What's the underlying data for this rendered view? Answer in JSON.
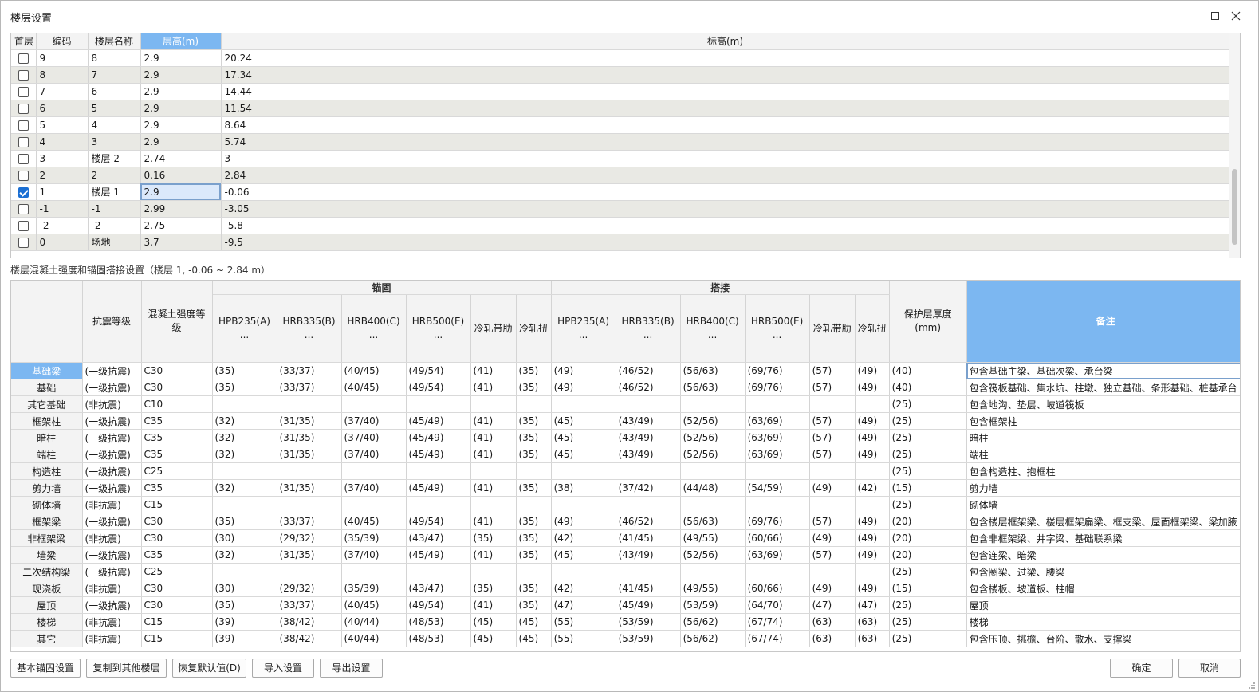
{
  "window": {
    "title": "楼层设置",
    "maximize_icon": "maximize-icon",
    "close_icon": "close-icon"
  },
  "floor_table": {
    "headers": [
      "首层",
      "编码",
      "楼层名称",
      "层高(m)",
      "标高(m)"
    ],
    "rows": [
      {
        "checked": false,
        "code": "9",
        "name": "8",
        "height": "2.9",
        "elevation": "20.24"
      },
      {
        "checked": false,
        "code": "8",
        "name": "7",
        "height": "2.9",
        "elevation": "17.34"
      },
      {
        "checked": false,
        "code": "7",
        "name": "6",
        "height": "2.9",
        "elevation": "14.44"
      },
      {
        "checked": false,
        "code": "6",
        "name": "5",
        "height": "2.9",
        "elevation": "11.54"
      },
      {
        "checked": false,
        "code": "5",
        "name": "4",
        "height": "2.9",
        "elevation": "8.64"
      },
      {
        "checked": false,
        "code": "4",
        "name": "3",
        "height": "2.9",
        "elevation": "5.74"
      },
      {
        "checked": false,
        "code": "3",
        "name": "楼层 2",
        "height": "2.74",
        "elevation": "3"
      },
      {
        "checked": false,
        "code": "2",
        "name": "2",
        "height": "0.16",
        "elevation": "2.84"
      },
      {
        "checked": true,
        "code": "1",
        "name": "楼层 1",
        "height": "2.9",
        "elevation": "-0.06"
      },
      {
        "checked": false,
        "code": "-1",
        "name": "-1",
        "height": "2.99",
        "elevation": "-3.05"
      },
      {
        "checked": false,
        "code": "-2",
        "name": "-2",
        "height": "2.75",
        "elevation": "-5.8"
      },
      {
        "checked": false,
        "code": "0",
        "name": "场地",
        "height": "3.7",
        "elevation": "-9.5"
      }
    ]
  },
  "section_label": "楼层混凝土强度和锚固搭接设置（楼层 1, -0.06 ~ 2.84 m）",
  "anchor_table": {
    "group_headers": {
      "anchor": "锚固",
      "lap": "搭接"
    },
    "headers": {
      "seismic": "抗震等级",
      "concrete": "混凝土强度等级",
      "hpb235": "HPB235(A) ...",
      "hrb335": "HRB335(B) ...",
      "hrb400": "HRB400(C) ...",
      "hrb500": "HRB500(E) ...",
      "cold_ribbed": "冷轧带肋",
      "cold_twisted": "冷轧扭",
      "cover": "保护层厚度(mm)",
      "note": "备注"
    },
    "rows": [
      {
        "name": "基础梁",
        "seismic": "(一级抗震)",
        "concrete": "C30",
        "anchor": [
          "(35)",
          "(33/37)",
          "(40/45)",
          "(49/54)",
          "(41)",
          "(35)"
        ],
        "lap": [
          "(49)",
          "(46/52)",
          "(56/63)",
          "(69/76)",
          "(57)",
          "(49)"
        ],
        "cover": "(40)",
        "note": "包含基础主梁、基础次梁、承台梁"
      },
      {
        "name": "基础",
        "seismic": "(一级抗震)",
        "concrete": "C30",
        "anchor": [
          "(35)",
          "(33/37)",
          "(40/45)",
          "(49/54)",
          "(41)",
          "(35)"
        ],
        "lap": [
          "(49)",
          "(46/52)",
          "(56/63)",
          "(69/76)",
          "(57)",
          "(49)"
        ],
        "cover": "(40)",
        "note": "包含筏板基础、集水坑、柱墩、独立基础、条形基础、桩基承台"
      },
      {
        "name": "其它基础",
        "seismic": "(非抗震)",
        "concrete": "C10",
        "anchor": [
          "",
          "",
          "",
          "",
          "",
          ""
        ],
        "lap": [
          "",
          "",
          "",
          "",
          "",
          ""
        ],
        "cover": "(25)",
        "note": "包含地沟、垫层、坡道筏板"
      },
      {
        "name": "框架柱",
        "seismic": "(一级抗震)",
        "concrete": "C35",
        "anchor": [
          "(32)",
          "(31/35)",
          "(37/40)",
          "(45/49)",
          "(41)",
          "(35)"
        ],
        "lap": [
          "(45)",
          "(43/49)",
          "(52/56)",
          "(63/69)",
          "(57)",
          "(49)"
        ],
        "cover": "(25)",
        "note": "包含框架柱"
      },
      {
        "name": "暗柱",
        "seismic": "(一级抗震)",
        "concrete": "C35",
        "anchor": [
          "(32)",
          "(31/35)",
          "(37/40)",
          "(45/49)",
          "(41)",
          "(35)"
        ],
        "lap": [
          "(45)",
          "(43/49)",
          "(52/56)",
          "(63/69)",
          "(57)",
          "(49)"
        ],
        "cover": "(25)",
        "note": "暗柱"
      },
      {
        "name": "端柱",
        "seismic": "(一级抗震)",
        "concrete": "C35",
        "anchor": [
          "(32)",
          "(31/35)",
          "(37/40)",
          "(45/49)",
          "(41)",
          "(35)"
        ],
        "lap": [
          "(45)",
          "(43/49)",
          "(52/56)",
          "(63/69)",
          "(57)",
          "(49)"
        ],
        "cover": "(25)",
        "note": "端柱"
      },
      {
        "name": "构造柱",
        "seismic": "(一级抗震)",
        "concrete": "C25",
        "anchor": [
          "",
          "",
          "",
          "",
          "",
          ""
        ],
        "lap": [
          "",
          "",
          "",
          "",
          "",
          ""
        ],
        "cover": "(25)",
        "note": "包含构造柱、抱框柱"
      },
      {
        "name": "剪力墙",
        "seismic": "(一级抗震)",
        "concrete": "C35",
        "anchor": [
          "(32)",
          "(31/35)",
          "(37/40)",
          "(45/49)",
          "(41)",
          "(35)"
        ],
        "lap": [
          "(38)",
          "(37/42)",
          "(44/48)",
          "(54/59)",
          "(49)",
          "(42)"
        ],
        "cover": "(15)",
        "note": "剪力墙"
      },
      {
        "name": "砌体墙",
        "seismic": "(非抗震)",
        "concrete": "C15",
        "anchor": [
          "",
          "",
          "",
          "",
          "",
          ""
        ],
        "lap": [
          "",
          "",
          "",
          "",
          "",
          ""
        ],
        "cover": "(25)",
        "note": "砌体墙"
      },
      {
        "name": "框架梁",
        "seismic": "(一级抗震)",
        "concrete": "C30",
        "anchor": [
          "(35)",
          "(33/37)",
          "(40/45)",
          "(49/54)",
          "(41)",
          "(35)"
        ],
        "lap": [
          "(49)",
          "(46/52)",
          "(56/63)",
          "(69/76)",
          "(57)",
          "(49)"
        ],
        "cover": "(20)",
        "note": "包含楼层框架梁、楼层框架扁梁、框支梁、屋面框架梁、梁加腋"
      },
      {
        "name": "非框架梁",
        "seismic": "(非抗震)",
        "concrete": "C30",
        "anchor": [
          "(30)",
          "(29/32)",
          "(35/39)",
          "(43/47)",
          "(35)",
          "(35)"
        ],
        "lap": [
          "(42)",
          "(41/45)",
          "(49/55)",
          "(60/66)",
          "(49)",
          "(49)"
        ],
        "cover": "(20)",
        "note": "包含非框架梁、井字梁、基础联系梁"
      },
      {
        "name": "墙梁",
        "seismic": "(一级抗震)",
        "concrete": "C35",
        "anchor": [
          "(32)",
          "(31/35)",
          "(37/40)",
          "(45/49)",
          "(41)",
          "(35)"
        ],
        "lap": [
          "(45)",
          "(43/49)",
          "(52/56)",
          "(63/69)",
          "(57)",
          "(49)"
        ],
        "cover": "(20)",
        "note": "包含连梁、暗梁"
      },
      {
        "name": "二次结构梁",
        "seismic": "(一级抗震)",
        "concrete": "C25",
        "anchor": [
          "",
          "",
          "",
          "",
          "",
          ""
        ],
        "lap": [
          "",
          "",
          "",
          "",
          "",
          ""
        ],
        "cover": "(25)",
        "note": "包含圈梁、过梁、腰梁"
      },
      {
        "name": "现浇板",
        "seismic": "(非抗震)",
        "concrete": "C30",
        "anchor": [
          "(30)",
          "(29/32)",
          "(35/39)",
          "(43/47)",
          "(35)",
          "(35)"
        ],
        "lap": [
          "(42)",
          "(41/45)",
          "(49/55)",
          "(60/66)",
          "(49)",
          "(49)"
        ],
        "cover": "(15)",
        "note": "包含楼板、坡道板、柱帽"
      },
      {
        "name": "屋顶",
        "seismic": "(一级抗震)",
        "concrete": "C30",
        "anchor": [
          "(35)",
          "(33/37)",
          "(40/45)",
          "(49/54)",
          "(41)",
          "(35)"
        ],
        "lap": [
          "(47)",
          "(45/49)",
          "(53/59)",
          "(64/70)",
          "(47)",
          "(47)"
        ],
        "cover": "(25)",
        "note": "屋顶"
      },
      {
        "name": "楼梯",
        "seismic": "(非抗震)",
        "concrete": "C15",
        "anchor": [
          "(39)",
          "(38/42)",
          "(40/44)",
          "(48/53)",
          "(45)",
          "(45)"
        ],
        "lap": [
          "(55)",
          "(53/59)",
          "(56/62)",
          "(67/74)",
          "(63)",
          "(63)"
        ],
        "cover": "(25)",
        "note": "楼梯"
      },
      {
        "name": "其它",
        "seismic": "(非抗震)",
        "concrete": "C15",
        "anchor": [
          "(39)",
          "(38/42)",
          "(40/44)",
          "(48/53)",
          "(45)",
          "(45)"
        ],
        "lap": [
          "(55)",
          "(53/59)",
          "(56/62)",
          "(67/74)",
          "(63)",
          "(63)"
        ],
        "cover": "(25)",
        "note": "包含压顶、挑檐、台阶、散水、支撑梁"
      }
    ]
  },
  "buttons": {
    "basic_anchor": "基本锚固设置",
    "copy_floors": "复制到其他楼层",
    "restore_default": "恢复默认值(D)",
    "import": "导入设置",
    "export": "导出设置",
    "ok": "确定",
    "cancel": "取消"
  },
  "colors": {
    "header_active": "#7cb7f1",
    "alt_row": "#e9e9e4",
    "checkbox_checked": "#1b6fd3"
  }
}
